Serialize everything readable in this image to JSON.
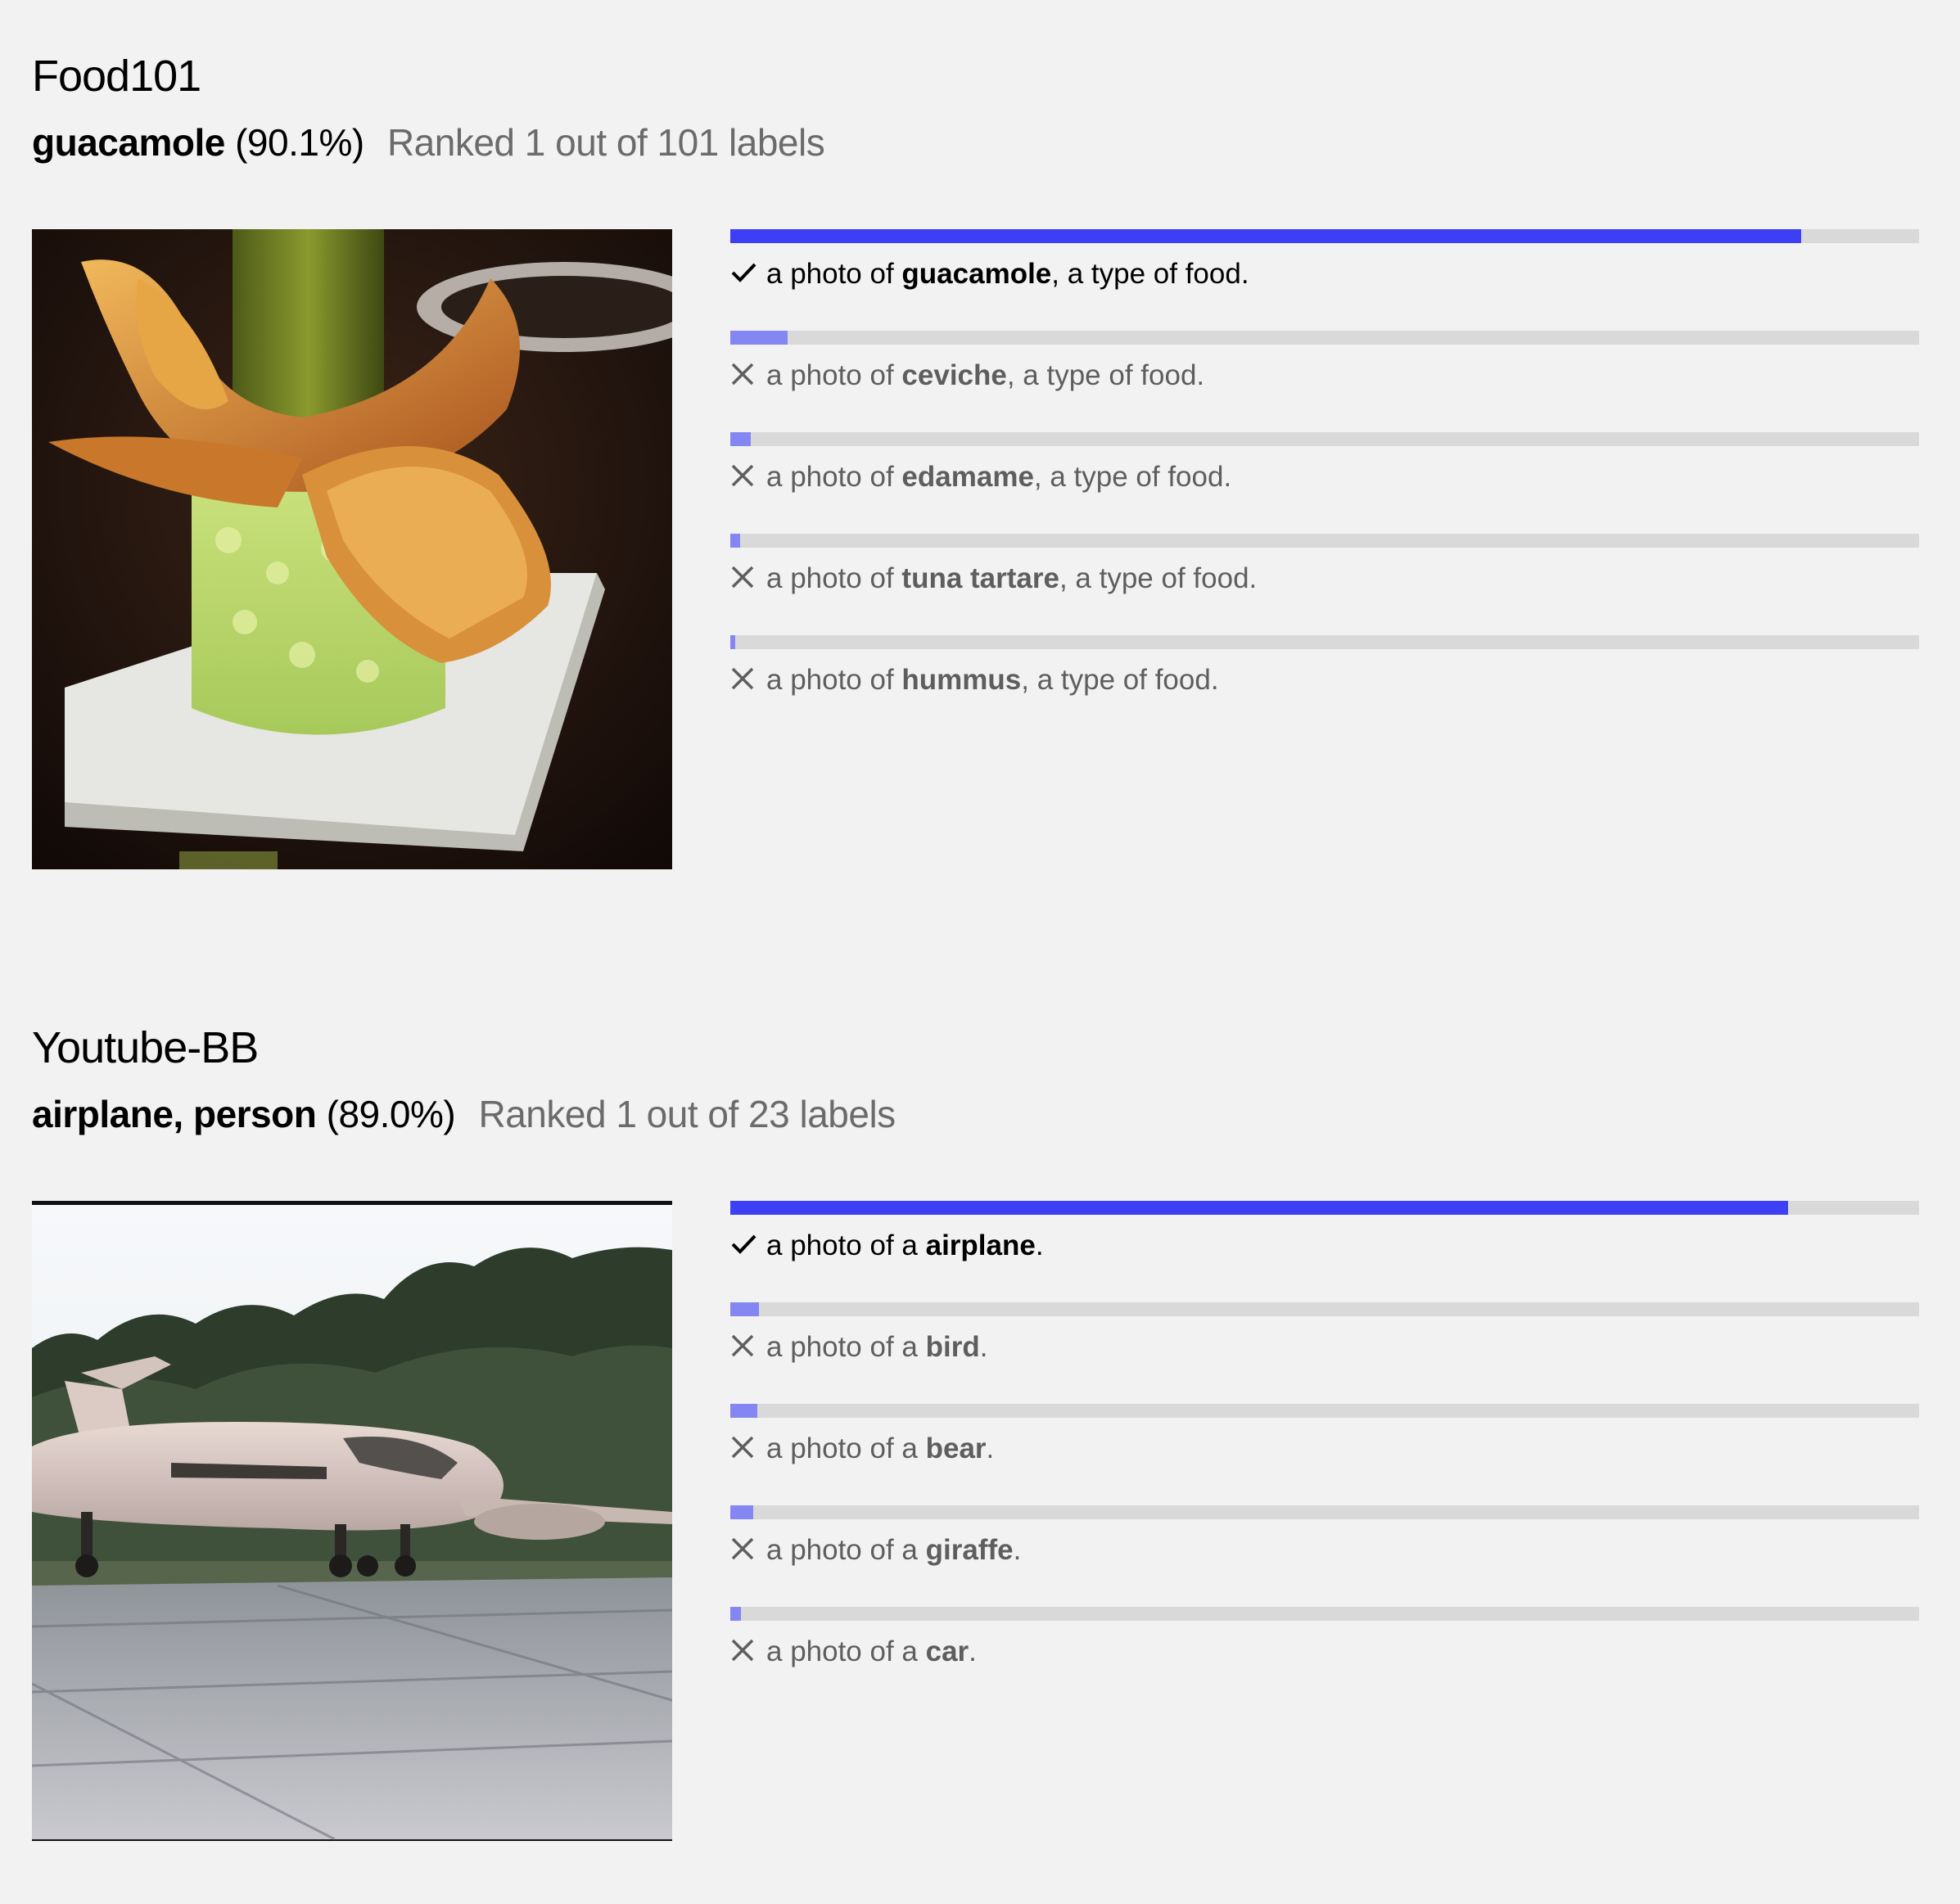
{
  "colors": {
    "background": "#f2f2f2",
    "top_bar": "#3d3ff5",
    "other_bar": "#8486f2",
    "track": "#d9d9d9",
    "muted_text": "#5e5e5e"
  },
  "sections": [
    {
      "title": "Food101",
      "result": {
        "label": "guacamole",
        "percent": "(90.1%)",
        "rank": "Ranked 1 out of 101 labels"
      },
      "image": "guacamole-photo",
      "predictions": [
        {
          "prefix": "a photo of ",
          "label": "guacamole",
          "suffix": ", a type of food.",
          "correct": true,
          "score": 0.901,
          "icon": "check-icon"
        },
        {
          "prefix": "a photo of ",
          "label": "ceviche",
          "suffix": ", a type of food.",
          "correct": false,
          "score": 0.048,
          "icon": "cross-icon"
        },
        {
          "prefix": "a photo of ",
          "label": "edamame",
          "suffix": ", a type of food.",
          "correct": false,
          "score": 0.017,
          "icon": "cross-icon"
        },
        {
          "prefix": "a photo of ",
          "label": "tuna tartare",
          "suffix": ", a type of food.",
          "correct": false,
          "score": 0.008,
          "icon": "cross-icon"
        },
        {
          "prefix": "a photo of ",
          "label": "hummus",
          "suffix": ", a type of food.",
          "correct": false,
          "score": 0.004,
          "icon": "cross-icon"
        }
      ]
    },
    {
      "title": "Youtube-BB",
      "result": {
        "label": "airplane, person",
        "percent": "(89.0%)",
        "rank": "Ranked 1 out of 23 labels"
      },
      "image": "airplane-photo",
      "predictions": [
        {
          "prefix": "a photo of a ",
          "label": "airplane",
          "suffix": ".",
          "correct": true,
          "score": 0.89,
          "icon": "check-icon"
        },
        {
          "prefix": "a photo of a ",
          "label": "bird",
          "suffix": ".",
          "correct": false,
          "score": 0.024,
          "icon": "cross-icon"
        },
        {
          "prefix": "a photo of a ",
          "label": "bear",
          "suffix": ".",
          "correct": false,
          "score": 0.023,
          "icon": "cross-icon"
        },
        {
          "prefix": "a photo of a ",
          "label": "giraffe",
          "suffix": ".",
          "correct": false,
          "score": 0.019,
          "icon": "cross-icon"
        },
        {
          "prefix": "a photo of a ",
          "label": "car",
          "suffix": ".",
          "correct": false,
          "score": 0.009,
          "icon": "cross-icon"
        }
      ]
    }
  ]
}
